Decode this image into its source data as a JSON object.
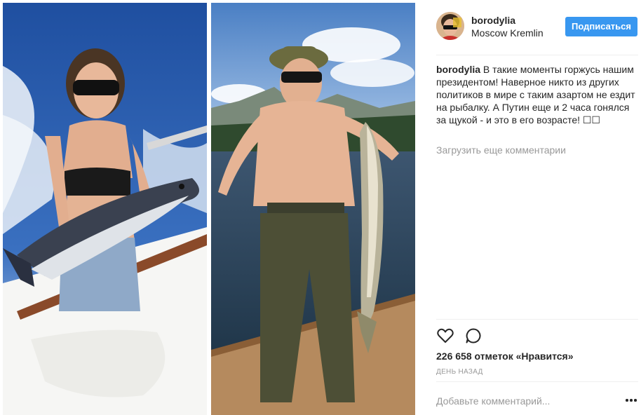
{
  "post": {
    "username": "borodylia",
    "location": "Moscow Kremlin",
    "follow_label": "Подписаться",
    "caption_user": "borodylia",
    "caption_text": "В такие моменты горжусь нашим президентом! Наверное никто из других политиков в мире с таким азартом не ездит на рыбалку. А Путин еще и 2 часа гонялся за щукой - и это в его возрасте! ☐☐",
    "load_more_label": "Загрузить еще комментарии",
    "likes_text": "226 658 отметок «Нравится»",
    "time_text": "ДЕНЬ НАЗАД",
    "comment_placeholder": "Добавьте комментарий..."
  },
  "icons": {
    "like": "heart-icon",
    "comment": "speech-bubble-icon",
    "more": "ellipsis-icon"
  },
  "colors": {
    "follow_button": "#3897f0",
    "muted_text": "#999999",
    "primary_text": "#262626",
    "divider": "#efefef"
  }
}
